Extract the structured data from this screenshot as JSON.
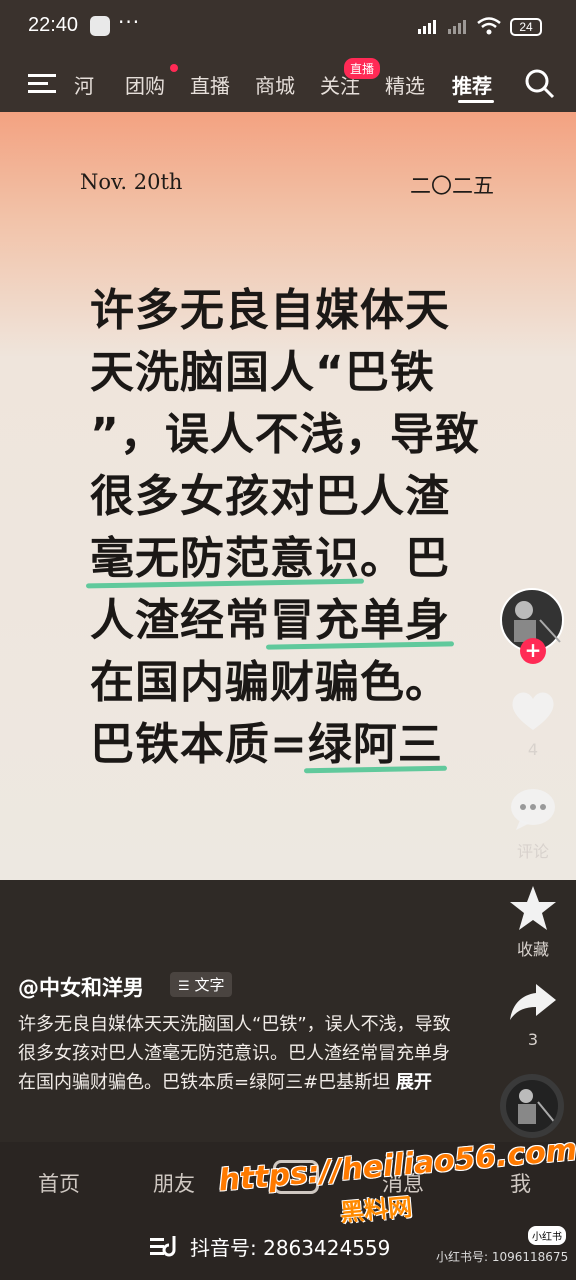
{
  "status_bar": {
    "time": "22:40",
    "dots": "···",
    "battery": "24"
  },
  "top_nav": {
    "tabs": [
      "河",
      "团购",
      "直播",
      "商城",
      "关注",
      "精选",
      "推荐"
    ],
    "live_badge": "直播",
    "active_tab": "推荐"
  },
  "card": {
    "date": "Nov. 20th",
    "year": "二〇二五",
    "lines": [
      [
        "许多无良自媒体天",
        ""
      ],
      [
        "天洗脑国人“巴铁",
        ""
      ],
      [
        "”，误人不浅，导致",
        ""
      ],
      [
        "很多女孩对巴人渣",
        ""
      ],
      [
        "毫无防范意识",
        "。巴"
      ],
      [
        "人渣经常",
        "冒充单身"
      ],
      [
        "在国内骗财骗色。",
        ""
      ],
      [
        "巴铁本质=",
        "绿阿三"
      ]
    ]
  },
  "sidebar": {
    "likes": "4",
    "comment_label": "评论",
    "favorite_label": "收藏",
    "shares": "3"
  },
  "post": {
    "author": "@中女和洋男",
    "tag": "文字",
    "description": "许多无良自媒体天天洗脑国人“巴铁”，误人不浅，导致很多女孩对巴人渣毫无防范意识。巴人渣经常冒充单身在国内骗财骗色。巴铁本质=绿阿三#巴基斯坦",
    "expand": "展开"
  },
  "bottom_nav": {
    "tabs": [
      "首页",
      "朋友",
      "",
      "消息",
      "我"
    ]
  },
  "footer": {
    "douyin_id": "抖音号: 2863424559",
    "xhs_id": "小红书号: 1096118675",
    "xhs_logo": "小红书"
  },
  "watermark": {
    "url": "https://heiliao56.com",
    "name": "黑料网"
  },
  "colors": {
    "accent": "#ff2a55",
    "highlight": "#61c99c",
    "bg": "#2a2522"
  }
}
